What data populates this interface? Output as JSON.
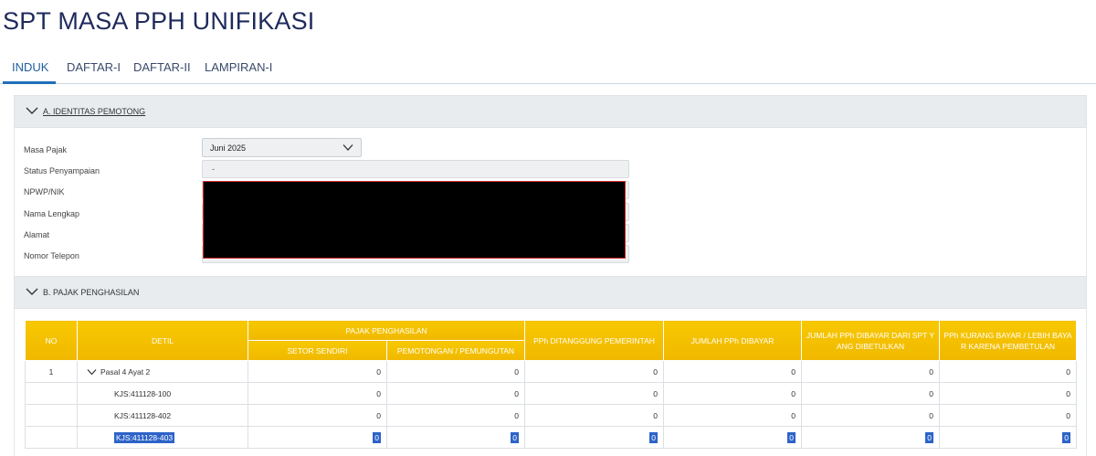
{
  "page": {
    "title": "SPT MASA PPH UNIFIKASI"
  },
  "tabs": [
    {
      "label": "INDUK",
      "active": true
    },
    {
      "label": "DAFTAR-I",
      "active": false
    },
    {
      "label": "DAFTAR-II",
      "active": false
    },
    {
      "label": "LAMPIRAN-I",
      "active": false
    }
  ],
  "section_a": {
    "label": "A. IDENTITAS PEMOTONG",
    "fields": {
      "masa_pajak_label": "Masa Pajak",
      "masa_pajak_value": "Juni 2025",
      "status_label": "Status Penyampaian",
      "status_value": "-",
      "npwp_label": "NPWP/NIK",
      "nama_label": "Nama Lengkap",
      "alamat_label": "Alamat",
      "telepon_label": "Nomor Telepon"
    }
  },
  "section_b": {
    "label": "B. PAJAK PENGHASILAN",
    "table": {
      "headers": {
        "no": "NO",
        "detil": "DETIL",
        "pajak_penghasilan": "PAJAK PENGHASILAN",
        "setor_sendiri": "SETOR SENDIRI",
        "pemotongan": "PEMOTONGAN / PEMUNGUTAN",
        "ditanggung": "PPh DITANGGUNG PEMERINTAH",
        "jumlah": "JUMLAH PPh DIBAYAR",
        "jumlah_spt": "JUMLAH PPh DIBAYAR DARI SPT Y ANG DIBETULKAN",
        "kurang_bayar": "PPh KURANG BAYAR / LEBIH BAYA R KARENA PEMBETULAN"
      },
      "rows": [
        {
          "no": "1",
          "detil": "Pasal 4 Ayat 2",
          "v1": "0",
          "v2": "0",
          "v3": "0",
          "v4": "0",
          "v5": "0",
          "v6": "0"
        },
        {
          "no": "",
          "detil": "KJS:411128-100",
          "v1": "0",
          "v2": "0",
          "v3": "0",
          "v4": "0",
          "v5": "0",
          "v6": "0"
        },
        {
          "no": "",
          "detil": "KJS:411128-402",
          "v1": "0",
          "v2": "0",
          "v3": "0",
          "v4": "0",
          "v5": "0",
          "v6": "0"
        },
        {
          "no": "",
          "detil": "KJS:411128-403",
          "v1": "0",
          "v2": "0",
          "v3": "0",
          "v4": "0",
          "v5": "0",
          "v6": "0"
        }
      ]
    }
  },
  "icons": {
    "section_toggle": "chevron-down-icon",
    "select_toggle": "chevron-down-icon"
  },
  "colors": {
    "header_gold": "#f0b800",
    "accent_blue": "#1f6fb8",
    "title_navy": "#1f2a5c"
  }
}
